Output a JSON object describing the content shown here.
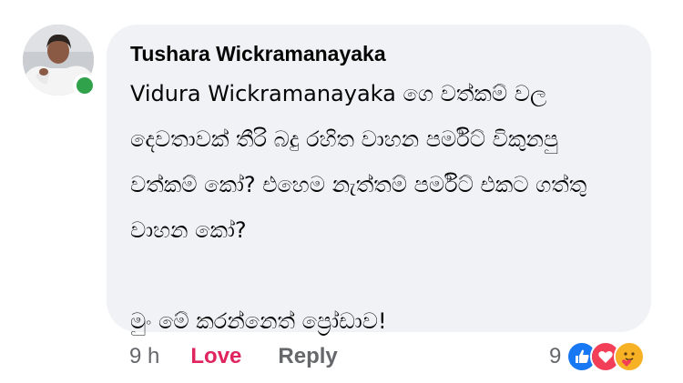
{
  "comment": {
    "author": "Tushara Wickramanayaka",
    "author_online": true,
    "body_lines": [
      "Vidura Wickramanayaka ගෙ වත්කම් වල",
      "දෙවතාවක් තීරි බදු රහිත වාහන පර්මිට් විකුනපු",
      "වත්කම් කෝ? එහෙම නැත්තම් පර්මිට් එකට ගත්තු",
      "වාහන කෝ?",
      "",
      "මුං මේ කරන්නෙත් ප්‍රෝඩාව!"
    ],
    "timestamp": "9 h",
    "love_label": "Love",
    "reply_label": "Reply",
    "reaction_count": "9",
    "reactions": [
      "like-icon",
      "love-icon",
      "care-icon"
    ],
    "colors": {
      "bubble_bg": "#f0f2f5",
      "love": "#e0245e",
      "online": "#31a24c",
      "like": "#1877f2",
      "muted": "#65676b"
    }
  }
}
